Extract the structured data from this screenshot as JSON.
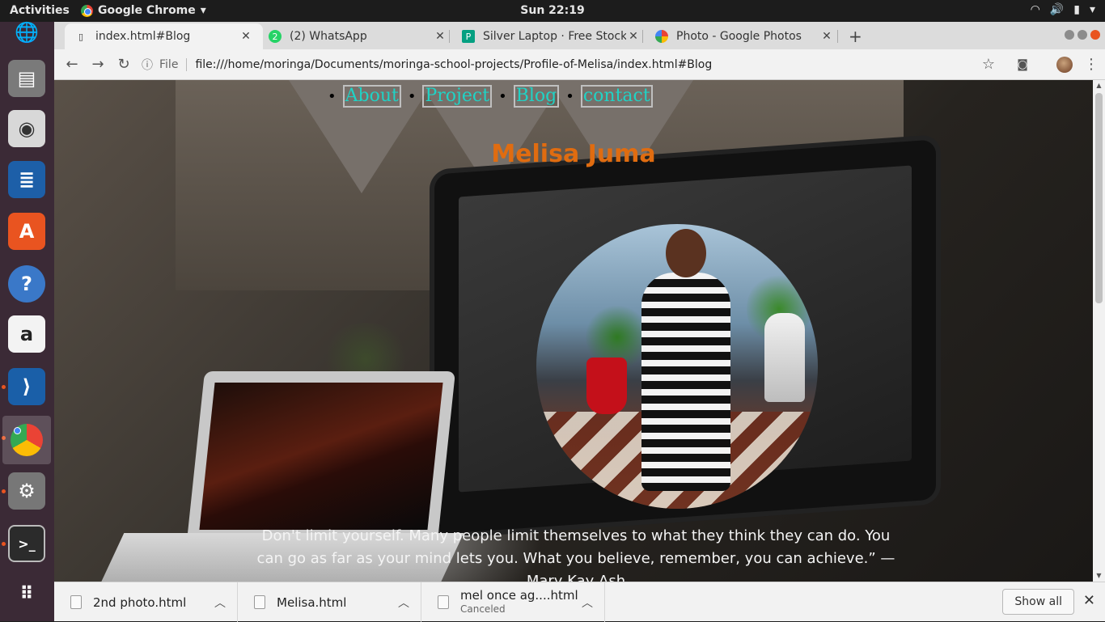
{
  "os_bar": {
    "activities": "Activities",
    "app_name": "Google Chrome",
    "clock": "Sun 22:19"
  },
  "tabs": [
    {
      "title": "index.html#Blog",
      "active": true
    },
    {
      "title": "(2) WhatsApp",
      "active": false
    },
    {
      "title": "Silver Laptop · Free Stock",
      "active": false
    },
    {
      "title": "Photo - Google Photos",
      "active": false
    }
  ],
  "toolbar": {
    "scheme_label": "File",
    "url": "file:///home/moringa/Documents/moringa-school-projects/Profile-of-Melisa/index.html#Blog"
  },
  "page": {
    "nav": [
      "About",
      "Project",
      "Blog",
      "contact"
    ],
    "name": "Melisa Juma",
    "quote": "Don't limit yourself. Many people limit themselves to what they think they can do. You can go as far as your mind lets you. What you believe, remember, you can achieve.” — Mary Kay Ash"
  },
  "downloads": [
    {
      "file": "2nd photo.html",
      "status": ""
    },
    {
      "file": "Melisa.html",
      "status": ""
    },
    {
      "file": "mel once ag....html",
      "status": "Canceled"
    }
  ],
  "shelf": {
    "show_all": "Show all"
  },
  "colors": {
    "nav_link": "#1fd3c6",
    "name": "#e06c10",
    "dock": "#3b2a36",
    "accent": "#e95420"
  }
}
